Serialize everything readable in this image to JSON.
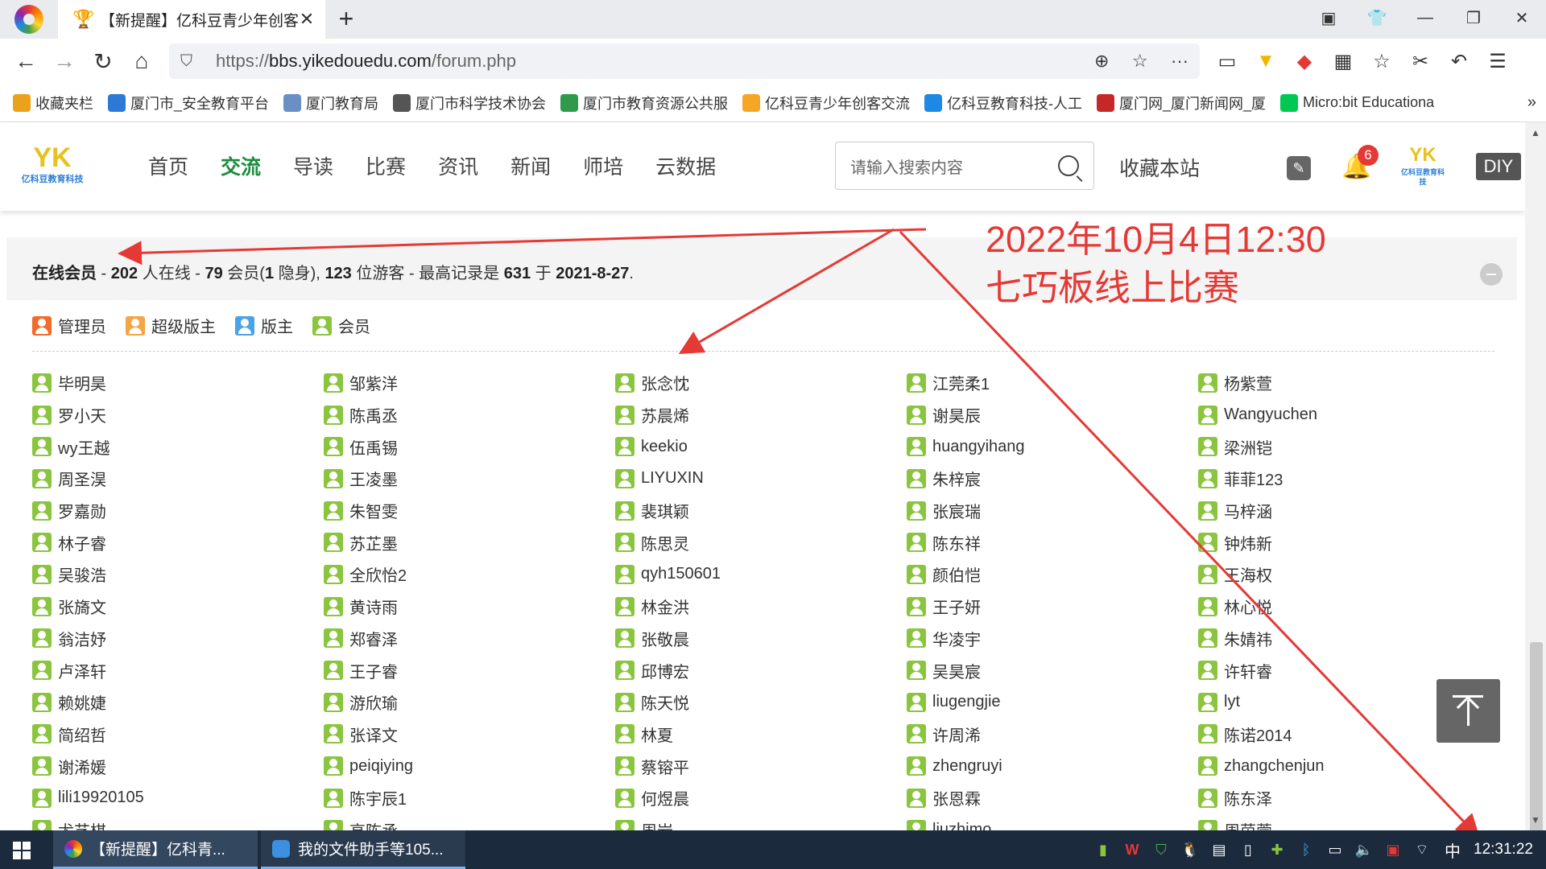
{
  "browser": {
    "tab_title": "【新提醒】亿科豆青少年创客",
    "url_prefix": "https://",
    "url_host": "bbs.yikedouedu.com",
    "url_path": "/forum.php"
  },
  "bookmarks": [
    {
      "label": "收藏夹栏",
      "color": "#e9a21a"
    },
    {
      "label": "厦门市_安全教育平台",
      "color": "#2d7ad6"
    },
    {
      "label": "厦门教育局",
      "color": "#6a8fc7"
    },
    {
      "label": "厦门市科学技术协会",
      "color": "#555555"
    },
    {
      "label": "厦门市教育资源公共服",
      "color": "#2e9a4a"
    },
    {
      "label": "亿科豆青少年创客交流",
      "color": "#f5a623"
    },
    {
      "label": "亿科豆教育科技-人工",
      "color": "#1e88e5"
    },
    {
      "label": "厦门网_厦门新闻网_厦",
      "color": "#c62828"
    },
    {
      "label": "Micro:bit Educationa",
      "color": "#00c853"
    }
  ],
  "site": {
    "logo_text": "YK",
    "logo_sub": "亿科豆教育科技",
    "nav": [
      "首页",
      "交流",
      "导读",
      "比赛",
      "资讯",
      "新闻",
      "师培",
      "云数据"
    ],
    "active_nav": "交流",
    "search_placeholder": "请输入搜索内容",
    "favorite_label": "收藏本站",
    "notification_count": "6",
    "diy_label": "DIY"
  },
  "online": {
    "label": "在线会员",
    "sep1": " - ",
    "total": "202",
    "total_text": " 人在线 - ",
    "members": "79",
    "members_text": " 会员(",
    "hidden": "1",
    "hidden_text": " 隐身), ",
    "guests": "123",
    "guests_text": " 位游客 - 最高记录是 ",
    "record": "631",
    "record_text": " 于 ",
    "record_date": "2021-8-27",
    "end": "."
  },
  "legend": [
    {
      "label": "管理员",
      "type": "admin"
    },
    {
      "label": "超级版主",
      "type": "super"
    },
    {
      "label": "版主",
      "type": "mod"
    },
    {
      "label": "会员",
      "type": "member"
    }
  ],
  "members": [
    "毕明昊",
    "邹紫洋",
    "张念忱",
    "江莞柔1",
    "杨紫萱",
    "罗小天",
    "陈禹丞",
    "苏晨烯",
    "谢昊辰",
    "Wangyuchen",
    "wy王越",
    "伍禹锡",
    "keekio",
    "huangyihang",
    "梁洲铠",
    "周圣淏",
    "王凌墨",
    "LIYUXIN",
    "朱梓宸",
    "菲菲123",
    "罗嘉勋",
    "朱智雯",
    "裴琪颖",
    "张宸瑞",
    "马梓涵",
    "林子睿",
    "苏芷墨",
    "陈思灵",
    "陈东祥",
    "钟炜新",
    "吴骏浩",
    "全欣怡2",
    "qyh150601",
    "颜伯恺",
    "王海权",
    "张旖文",
    "黄诗雨",
    "林金洪",
    "王子妍",
    "林心悦",
    "翁洁妤",
    "郑睿泽",
    "张敬晨",
    "华凌宇",
    "朱婧祎",
    "卢泽轩",
    "王子睿",
    "邱博宏",
    "吴昊宸",
    "许轩睿",
    "赖姚婕",
    "游欣瑜",
    "陈天悦",
    "liugengjie",
    "lyt",
    "简绍哲",
    "张译文",
    "林夏",
    "许周浠",
    "陈诺2014",
    "谢浠媛",
    "peiqiying",
    "蔡镕平",
    "zhengruyi",
    "zhangchenjun",
    "lili19920105",
    "陈宇辰1",
    "何煜晨",
    "张恩霖",
    "陈东泽",
    "尤艺棋",
    "高陈承",
    "周岩",
    "liuzhimo",
    "周茵萱"
  ],
  "annotation": {
    "line1": "2022年10月4日12:30",
    "line2": "七巧板线上比赛",
    "color": "#e53935"
  },
  "taskbar": {
    "app1": "【新提醒】亿科青...",
    "app2": "我的文件助手等105...",
    "ime": "中",
    "clock": "12:31:22"
  }
}
